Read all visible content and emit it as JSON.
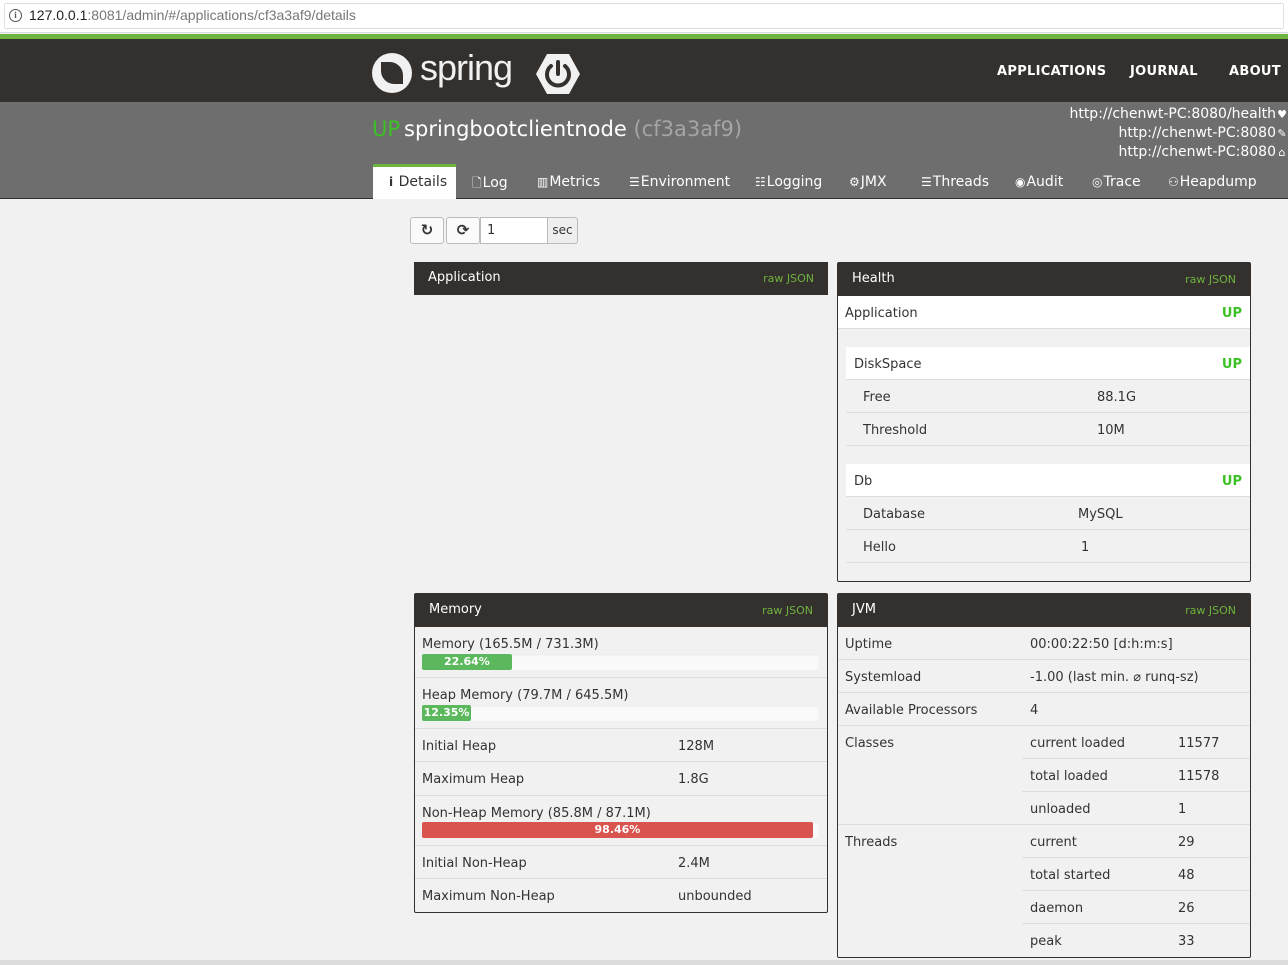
{
  "browser": {
    "url_host": "127.0.0.1",
    "url_rest": ":8081/admin/#/applications/cf3a3af9/details"
  },
  "header": {
    "logo_text": "spring",
    "nav": [
      "APPLICATIONS",
      "JOURNAL",
      "ABOUT"
    ]
  },
  "app": {
    "status": "UP",
    "name": "springbootclientnode",
    "id": "(cf3a3af9)",
    "urls": [
      {
        "text": "http://chenwt-PC:8080/health",
        "icon": "heart-icon"
      },
      {
        "text": "http://chenwt-PC:8080",
        "icon": "wrench-icon"
      },
      {
        "text": "http://chenwt-PC:8080",
        "icon": "home-icon"
      }
    ]
  },
  "tabs": [
    {
      "label": "Details",
      "icon": "info-icon"
    },
    {
      "label": "Log",
      "icon": "file-icon"
    },
    {
      "label": "Metrics",
      "icon": "bar-chart-icon"
    },
    {
      "label": "Environment",
      "icon": "list-icon"
    },
    {
      "label": "Logging",
      "icon": "sliders-icon"
    },
    {
      "label": "JMX",
      "icon": "cogs-icon"
    },
    {
      "label": "Threads",
      "icon": "align-justify-icon"
    },
    {
      "label": "Audit",
      "icon": "user-circle-icon"
    },
    {
      "label": "Trace",
      "icon": "eye-icon"
    },
    {
      "label": "Heapdump",
      "icon": "users-icon"
    }
  ],
  "controls": {
    "interval_value": "1",
    "interval_unit": "sec"
  },
  "raw_json": "raw JSON",
  "application_panel": {
    "title": "Application"
  },
  "health_panel": {
    "title": "Health",
    "application": {
      "label": "Application",
      "status": "UP"
    },
    "diskspace": {
      "label": "DiskSpace",
      "status": "UP",
      "rows": [
        {
          "label": "Free",
          "value": "88.1G"
        },
        {
          "label": "Threshold",
          "value": "10M"
        }
      ]
    },
    "db": {
      "label": "Db",
      "status": "UP",
      "rows": [
        {
          "label": "Database",
          "value": "MySQL"
        },
        {
          "label": "Hello",
          "value": "1"
        }
      ]
    }
  },
  "memory_panel": {
    "title": "Memory",
    "memory": {
      "label": "Memory (165.5M / 731.3M)",
      "percent_text": "22.64%",
      "percent": 22.64
    },
    "heap": {
      "label": "Heap Memory (79.7M / 645.5M)",
      "percent_text": "12.35%",
      "percent": 12.35
    },
    "rows1": [
      {
        "label": "Initial Heap",
        "value": "128M"
      },
      {
        "label": "Maximum Heap",
        "value": "1.8G"
      }
    ],
    "nonheap": {
      "label": "Non-Heap Memory (85.8M / 87.1M)",
      "percent_text": "98.46%",
      "percent": 98.46
    },
    "rows2": [
      {
        "label": "Initial Non-Heap",
        "value": "2.4M"
      },
      {
        "label": "Maximum Non-Heap",
        "value": "unbounded"
      }
    ]
  },
  "jvm_panel": {
    "title": "JVM",
    "uptime": {
      "label": "Uptime",
      "value": "00:00:22:50 [d:h:m:s]"
    },
    "systemload": {
      "label": "Systemload",
      "value": "-1.00 (last min. ⌀ runq-sz)"
    },
    "processors": {
      "label": "Available Processors",
      "value": "4"
    },
    "classes": {
      "label": "Classes",
      "rows": [
        {
          "label": "current loaded",
          "value": "11577"
        },
        {
          "label": "total loaded",
          "value": "11578"
        },
        {
          "label": "unloaded",
          "value": "1"
        }
      ]
    },
    "threads": {
      "label": "Threads",
      "rows": [
        {
          "label": "current",
          "value": "29"
        },
        {
          "label": "total started",
          "value": "48"
        },
        {
          "label": "daemon",
          "value": "26"
        },
        {
          "label": "peak",
          "value": "33"
        }
      ]
    }
  }
}
